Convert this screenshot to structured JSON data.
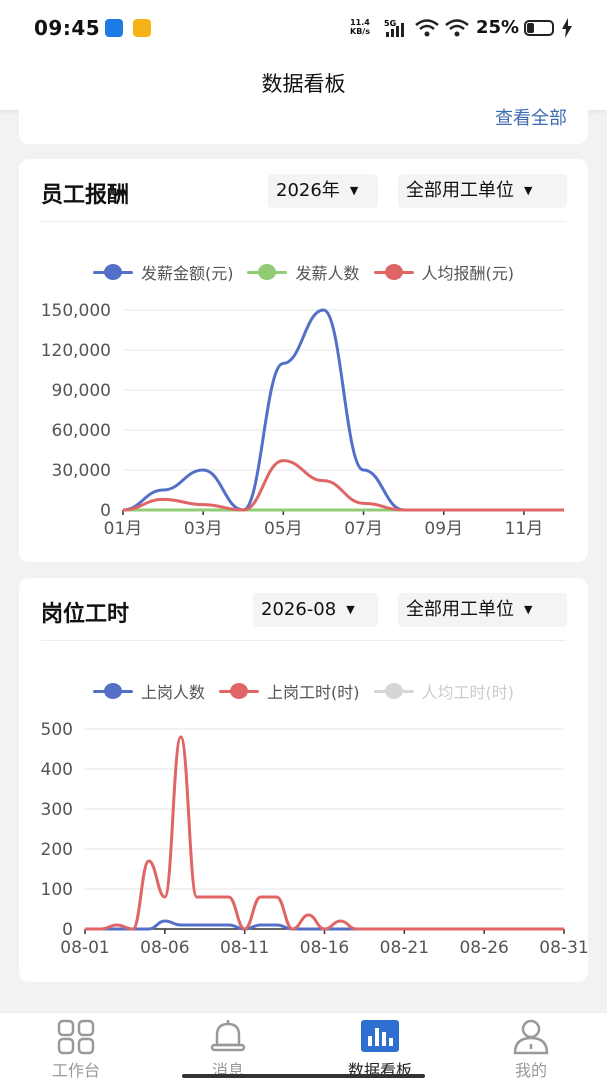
{
  "status_bar": {
    "time": "09:45",
    "net_speed": "11.4",
    "net_unit": "KB/s",
    "signal": "5G",
    "battery": "25%"
  },
  "header": {
    "title": "数据看板"
  },
  "prev_card": {
    "link": "查看全部"
  },
  "salary_card": {
    "title": "员工报酬",
    "year": "2026年",
    "unit": "全部用工单位",
    "legend": [
      "发薪金额(元)",
      "发薪人数",
      "人均报酬(元)"
    ]
  },
  "hours_card": {
    "title": "岗位工时",
    "month": "2026-08",
    "unit": "全部用工单位",
    "legend": [
      "上岗人数",
      "上岗工时(时)",
      "人均工时(时)"
    ]
  },
  "tabs": [
    {
      "label": "工作台",
      "icon": "grid-icon"
    },
    {
      "label": "消息",
      "icon": "bell-icon"
    },
    {
      "label": "数据看板",
      "icon": "chart-icon"
    },
    {
      "label": "我的",
      "icon": "user-icon"
    }
  ],
  "chart_data": [
    {
      "type": "line",
      "title": "员工报酬",
      "x": [
        "01月",
        "02月",
        "03月",
        "04月",
        "05月",
        "06月",
        "07月",
        "08月",
        "09月",
        "10月",
        "11月",
        "12月"
      ],
      "xticks": [
        "01月",
        "03月",
        "05月",
        "07月",
        "09月",
        "11月"
      ],
      "ylim": [
        0,
        150000
      ],
      "yticks": [
        "0",
        "30,000",
        "60,000",
        "90,000",
        "120,000",
        "150,000"
      ],
      "legend_position": "top",
      "series": [
        {
          "name": "发薪金额(元)",
          "color": "#5470c6",
          "values": [
            0,
            15000,
            30000,
            0,
            110000,
            150000,
            30000,
            0,
            0,
            0,
            0,
            0
          ]
        },
        {
          "name": "发薪人数",
          "color": "#91cc75",
          "values": [
            0,
            0,
            0,
            0,
            0,
            0,
            0,
            0,
            0,
            0,
            0,
            0
          ]
        },
        {
          "name": "人均报酬(元)",
          "color": "#e06666",
          "values": [
            0,
            8000,
            4000,
            0,
            37000,
            22000,
            5000,
            0,
            0,
            0,
            0,
            0
          ]
        }
      ]
    },
    {
      "type": "line",
      "title": "岗位工时",
      "x": [
        "08-01",
        "08-02",
        "08-03",
        "08-04",
        "08-05",
        "08-06",
        "08-07",
        "08-08",
        "08-09",
        "08-10",
        "08-11",
        "08-12",
        "08-13",
        "08-14",
        "08-15",
        "08-16",
        "08-17",
        "08-18",
        "08-19",
        "08-20",
        "08-21",
        "08-22",
        "08-23",
        "08-24",
        "08-25",
        "08-26",
        "08-27",
        "08-28",
        "08-29",
        "08-30",
        "08-31"
      ],
      "xticks": [
        "08-01",
        "08-06",
        "08-11",
        "08-16",
        "08-21",
        "08-26",
        "08-31"
      ],
      "ylim": [
        0,
        500
      ],
      "yticks": [
        "0",
        "100",
        "200",
        "300",
        "400",
        "500"
      ],
      "legend_position": "top",
      "series": [
        {
          "name": "上岗人数",
          "color": "#5470c6",
          "values": [
            0,
            0,
            0,
            0,
            0,
            20,
            10,
            10,
            10,
            10,
            0,
            10,
            10,
            0,
            0,
            0,
            0,
            0,
            0,
            0,
            0,
            0,
            0,
            0,
            0,
            0,
            0,
            0,
            0,
            0,
            0
          ]
        },
        {
          "name": "上岗工时(时)",
          "color": "#e06666",
          "values": [
            0,
            0,
            10,
            0,
            170,
            80,
            480,
            80,
            80,
            80,
            0,
            80,
            80,
            0,
            35,
            0,
            20,
            0,
            0,
            0,
            0,
            0,
            0,
            0,
            0,
            0,
            0,
            0,
            0,
            0,
            0
          ]
        },
        {
          "name": "人均工时(时)",
          "color": "#cccccc",
          "values": []
        }
      ]
    }
  ]
}
